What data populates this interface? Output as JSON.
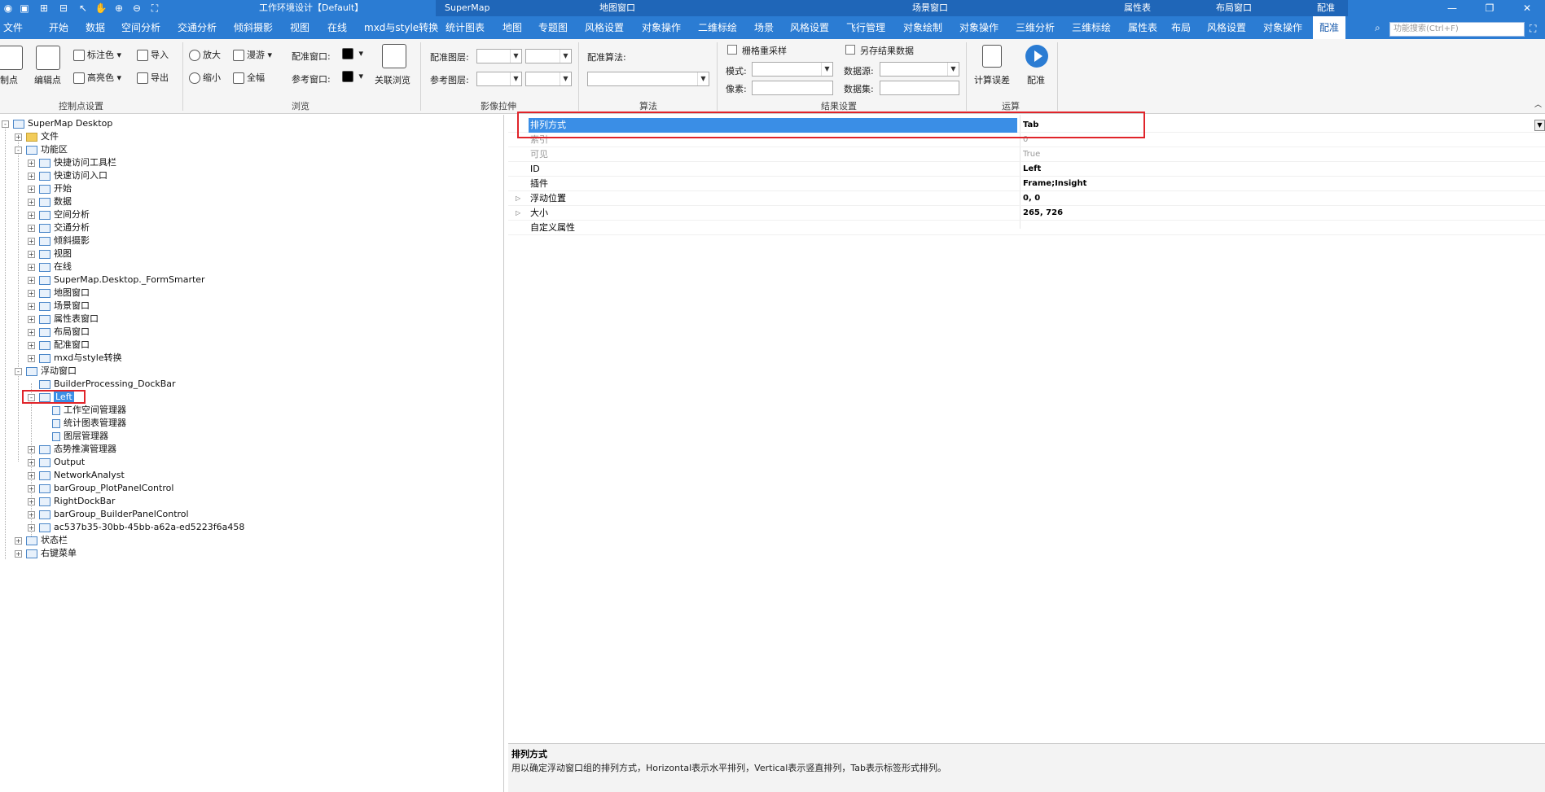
{
  "titlebar": {
    "title": "工作环境设计【Default】",
    "contexts": [
      "SuperMap",
      "地图窗口",
      "场景窗口",
      "属性表",
      "布局窗口",
      "配准"
    ],
    "min_icon": "minimize-icon",
    "restore_icon": "restore-icon",
    "close_icon": "close-icon"
  },
  "tabs": [
    "文件",
    "开始",
    "数据",
    "空间分析",
    "交通分析",
    "倾斜摄影",
    "视图",
    "在线",
    "mxd与style转换",
    "统计图表",
    "地图",
    "专题图",
    "风格设置",
    "对象操作",
    "二维标绘",
    "场景",
    "风格设置",
    "飞行管理",
    "对象绘制",
    "对象操作",
    "三维分析",
    "三维标绘",
    "属性表",
    "布局",
    "风格设置",
    "对象操作",
    "配准"
  ],
  "active_tab": "配准",
  "search": {
    "placeholder": "功能搜索(Ctrl+F)"
  },
  "ribbon": {
    "ctrl_point": "制点",
    "edit_point": "编辑点",
    "mark_color": "标注色",
    "highlight_color": "高亮色",
    "import": "导入",
    "export": "导出",
    "group_ctrl": "控制点设置",
    "zoom_in": "放大",
    "zoom_out": "缩小",
    "roam": "漫游",
    "full": "全幅",
    "reg_window": "配准窗口:",
    "ref_window": "参考窗口:",
    "linked_browse": "关联浏览",
    "group_browse": "浏览",
    "reg_layer": "配准图层:",
    "ref_layer": "参考图层:",
    "group_stretch": "影像拉伸",
    "algorithm": "配准算法:",
    "group_algo": "算法",
    "resample": "栅格重采样",
    "mode": "模式:",
    "pixel": "像素:",
    "save_as": "另存结果数据",
    "datasource": "数据源:",
    "dataset": "数据集:",
    "group_result": "结果设置",
    "calc_error": "计算误差",
    "register": "配准",
    "group_run": "运算"
  },
  "tree": [
    {
      "label": "SuperMap Desktop",
      "level": 0,
      "exp": "-",
      "icon": "monitor-icon"
    },
    {
      "label": "文件",
      "level": 1,
      "exp": "+",
      "icon": "folder-icon"
    },
    {
      "label": "功能区",
      "level": 1,
      "exp": "-",
      "icon": "window-icon"
    },
    {
      "label": "快捷访问工具栏",
      "level": 2,
      "exp": "+",
      "icon": "toolbar-icon"
    },
    {
      "label": "快速访问入口",
      "level": 2,
      "exp": "+",
      "icon": "search-icon"
    },
    {
      "label": "开始",
      "level": 2,
      "exp": "+",
      "icon": "tab-icon"
    },
    {
      "label": "数据",
      "level": 2,
      "exp": "+",
      "icon": "tab-icon"
    },
    {
      "label": "空间分析",
      "level": 2,
      "exp": "+",
      "icon": "tab-icon"
    },
    {
      "label": "交通分析",
      "level": 2,
      "exp": "+",
      "icon": "tab-icon"
    },
    {
      "label": "倾斜摄影",
      "level": 2,
      "exp": "+",
      "icon": "tab-icon"
    },
    {
      "label": "视图",
      "level": 2,
      "exp": "+",
      "icon": "tab-icon"
    },
    {
      "label": "在线",
      "level": 2,
      "exp": "+",
      "icon": "tab-icon"
    },
    {
      "label": "SuperMap.Desktop._FormSmarter",
      "level": 2,
      "exp": "+",
      "icon": "tab-icon"
    },
    {
      "label": "地图窗口",
      "level": 2,
      "exp": "+",
      "icon": "tab-icon"
    },
    {
      "label": "场景窗口",
      "level": 2,
      "exp": "+",
      "icon": "tab-icon"
    },
    {
      "label": "属性表窗口",
      "level": 2,
      "exp": "+",
      "icon": "tab-icon"
    },
    {
      "label": "布局窗口",
      "level": 2,
      "exp": "+",
      "icon": "tab-icon"
    },
    {
      "label": "配准窗口",
      "level": 2,
      "exp": "+",
      "icon": "tab-icon"
    },
    {
      "label": "mxd与style转换",
      "level": 2,
      "exp": "+",
      "icon": "tab-icon"
    },
    {
      "label": "浮动窗口",
      "level": 1,
      "exp": "-",
      "icon": "float-window-icon"
    },
    {
      "label": "BuilderProcessing_DockBar",
      "level": 2,
      "exp": "",
      "icon": "dockbar-icon"
    },
    {
      "label": "Left",
      "level": 2,
      "exp": "-",
      "icon": "dockbar-icon",
      "selected": true
    },
    {
      "label": "工作空间管理器",
      "level": 3,
      "exp": "",
      "icon": "panel-icon"
    },
    {
      "label": "统计图表管理器",
      "level": 3,
      "exp": "",
      "icon": "panel-icon"
    },
    {
      "label": "图层管理器",
      "level": 3,
      "exp": "",
      "icon": "panel-icon"
    },
    {
      "label": "态势推演管理器",
      "level": 2,
      "exp": "+",
      "icon": "dockbar-icon"
    },
    {
      "label": "Output",
      "level": 2,
      "exp": "+",
      "icon": "dockbar-icon"
    },
    {
      "label": "NetworkAnalyst",
      "level": 2,
      "exp": "+",
      "icon": "dockbar-icon"
    },
    {
      "label": "barGroup_PlotPanelControl",
      "level": 2,
      "exp": "+",
      "icon": "dockbar-icon"
    },
    {
      "label": "RightDockBar",
      "level": 2,
      "exp": "+",
      "icon": "dockbar-icon"
    },
    {
      "label": "barGroup_BuilderPanelControl",
      "level": 2,
      "exp": "+",
      "icon": "dockbar-icon"
    },
    {
      "label": "ac537b35-30bb-45bb-a62a-ed5223f6a458",
      "level": 2,
      "exp": "+",
      "icon": "dockbar-icon"
    },
    {
      "label": "状态栏",
      "level": 1,
      "exp": "+",
      "icon": "statusbar-icon"
    },
    {
      "label": "右键菜单",
      "level": 1,
      "exp": "+",
      "icon": "menu-icon"
    }
  ],
  "properties": [
    {
      "name": "排列方式",
      "value": "Tab",
      "selected": true,
      "expand": ""
    },
    {
      "name": "索引",
      "value": "0",
      "dim": true,
      "expand": ""
    },
    {
      "name": "可见",
      "value": "True",
      "dim": true,
      "expand": ""
    },
    {
      "name": "ID",
      "value": "Left",
      "expand": ""
    },
    {
      "name": "插件",
      "value": "Frame;Insight",
      "expand": ""
    },
    {
      "name": "浮动位置",
      "value": "0, 0",
      "expand": "▷"
    },
    {
      "name": "大小",
      "value": "265, 726",
      "expand": "▷"
    },
    {
      "name": "自定义属性",
      "value": "",
      "expand": ""
    }
  ],
  "description": {
    "title": "排列方式",
    "text": "用以确定浮动窗口组的排列方式，Horizontal表示水平排列，Vertical表示竖直排列，Tab表示标签形式排列。"
  },
  "colors": {
    "titlebar": "#2b7cd3",
    "selection": "#3a8ee6",
    "highlight_box": "#e0242a"
  }
}
